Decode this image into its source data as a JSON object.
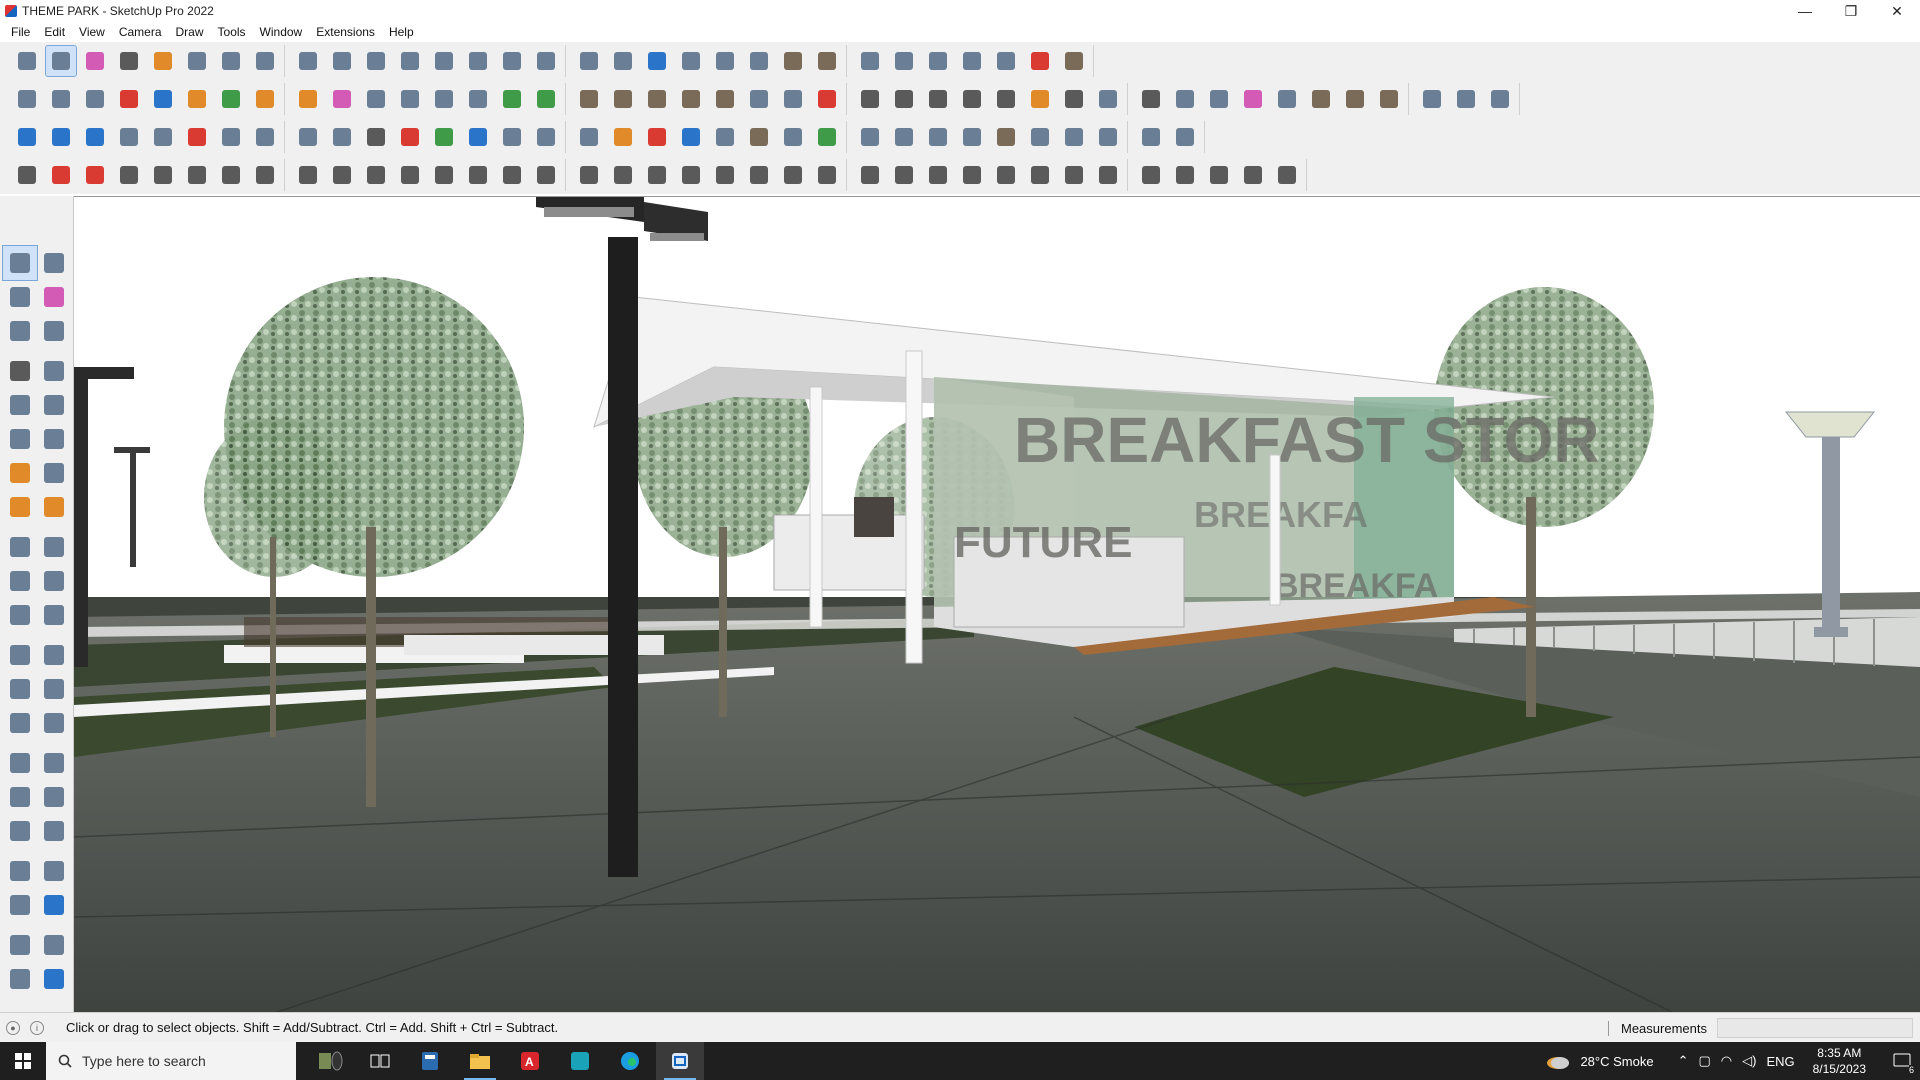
{
  "window": {
    "title": "THEME PARK - SketchUp Pro 2022",
    "controls": {
      "minimize": "—",
      "maximize": "❐",
      "close": "✕"
    }
  },
  "menu": [
    "File",
    "Edit",
    "View",
    "Camera",
    "Draw",
    "Tools",
    "Window",
    "Extensions",
    "Help"
  ],
  "toolbars": {
    "row1": [
      "zoom-icon",
      "select-icon",
      "eraser-icon",
      "line-icon",
      "arc-icon",
      "rectangle-icon",
      "push-pull-icon",
      "follow-me-icon",
      "move-icon",
      "rotate-icon",
      "scale-icon",
      "tape-measure-icon",
      "text-icon",
      "paint-bucket-icon",
      "orbit-icon",
      "pan-icon",
      "zoom-icon",
      "zoom-extents-icon",
      "section-plane-icon",
      "section-display-icon",
      "section-cut-icon",
      "section-fill-icon",
      "warehouse-icon",
      "extension-warehouse-icon",
      "layout-icon",
      "color-by-axis-icon",
      "components-icon",
      "styles-icon",
      "undo-icon",
      "redo-icon",
      "sandbox-icon"
    ],
    "row2": [
      "iso-view-icon",
      "top-view-icon",
      "front-view-icon",
      "push-pull-red-icon",
      "push-pull-blue-icon",
      "push-pull-orange-icon",
      "push-pull-green-icon",
      "push-pull-gold-icon",
      "push-pull-orange2-icon",
      "push-pull-magenta-icon",
      "soften-icon",
      "extrude-icon",
      "extrude2-icon",
      "extrude3-icon",
      "terrain-icon",
      "terrain2-icon",
      "house-icon",
      "house2-icon",
      "house3-icon",
      "house4-icon",
      "house5-icon",
      "formula-icon",
      "tag-icon",
      "pencil-red-icon",
      "rect-shape-icon",
      "circle-shape-icon",
      "polygon-shape-icon",
      "ellipse-shape-icon",
      "parallelogram-shape-icon",
      "arc-shape-icon",
      "spiral-shape-icon",
      "lasso-icon",
      "select-shape-icon",
      "target-icon",
      "dimension-icon",
      "eraser-pink-icon",
      "stairs-icon",
      "brick-icon",
      "roof-icon",
      "roof2-icon",
      "hand-icon",
      "floor-icon",
      "wall-icon"
    ],
    "row3": [
      "plane-blue-icon",
      "plane-blue2-icon",
      "plane-yellow-icon",
      "text-label-icon",
      "close-icon",
      "rect-red-icon",
      "frame-icon",
      "flag-icon",
      "door-icon",
      "bend-icon",
      "curve-dots-icon",
      "cross-red-icon",
      "cross-green-icon",
      "cross-blue-icon",
      "cone-icon",
      "tower-icon",
      "warning-icon",
      "arc-orange-icon",
      "arc-red-icon",
      "arc-blue-icon",
      "move-axis-icon",
      "box-icon",
      "arrow-back-icon",
      "tree-icon",
      "cube-group-icon",
      "cube-group2-icon",
      "gem-icon",
      "grid-icon",
      "box-outline-icon",
      "window-icon",
      "window2-icon",
      "dots-icon",
      "circle-dots-icon",
      "qr-icon"
    ],
    "row4": [
      "curve-icon",
      "spline-red-icon",
      "cube-red-icon",
      "line-tool-icon",
      "curve-tool-icon",
      "shape-icon",
      "shape2-icon",
      "shape3-icon",
      "shape4-icon",
      "shape5-icon",
      "line-a-icon",
      "line-b-icon",
      "line-c-icon",
      "line-d-icon",
      "line-e-icon",
      "line-f-icon",
      "line-g-icon",
      "line-h-icon",
      "line-i-icon",
      "line-j-icon",
      "line-k-icon",
      "line-l-icon",
      "line-m-icon",
      "line-n-icon",
      "line-o-icon",
      "line-p-icon",
      "line-q-icon",
      "line-r-icon",
      "line-s-icon",
      "line-t-icon",
      "line-u-icon",
      "line-v-icon",
      "line-w-icon",
      "line-x-icon",
      "line-y-icon",
      "line-z-icon",
      "line-aa-icon"
    ]
  },
  "tools_left": [
    [
      "select-icon",
      "orbit-icon"
    ],
    [
      "paint-bucket-icon",
      "eraser-icon"
    ],
    [
      "make-component-icon",
      "pencil-icon"
    ],
    [
      "line-icon",
      "freehand-icon"
    ],
    [
      "rectangle-icon",
      "rotated-rectangle-icon"
    ],
    [
      "circle-icon",
      "polygon-icon"
    ],
    [
      "arc-icon",
      "pie-icon"
    ],
    [
      "two-point-arc-icon",
      "three-point-arc-icon"
    ],
    [
      "move-icon",
      "push-pull-icon"
    ],
    [
      "rotate-icon",
      "follow-me-icon"
    ],
    [
      "scale-icon",
      "offset-icon"
    ],
    [
      "tape-measure-icon",
      "dimension-icon"
    ],
    [
      "protractor-icon",
      "text-icon"
    ],
    [
      "axes-icon",
      "3d-text-icon"
    ],
    [
      "orbit2-icon",
      "pan-icon"
    ],
    [
      "zoom-icon",
      "zoom-window-icon"
    ],
    [
      "zoom-extents-icon",
      "previous-view-icon"
    ],
    [
      "position-camera-icon",
      "look-around-icon"
    ],
    [
      "walk-icon",
      "section-plane-icon"
    ],
    [
      "section-display-icon",
      "section-cuts-icon"
    ],
    [
      "section-fill-icon",
      "section-plane2-icon"
    ]
  ],
  "status": {
    "message": "Click or drag to select objects. Shift = Add/Subtract. Ctrl = Add. Shift + Ctrl = Subtract.",
    "measurements_label": "Measurements",
    "measurements_value": ""
  },
  "taskbar": {
    "search_placeholder": "Type here to search",
    "weather": "28°C  Smoke",
    "language": "ENG",
    "time": "8:35 AM",
    "date": "8/15/2023",
    "notifications": "6"
  },
  "scene": {
    "sign_texts": [
      "BREAKFAST STOR",
      "FUTURE",
      "BREAKFA",
      "BREAKFA"
    ]
  },
  "colors": {
    "accent": "#0078d7",
    "sky": "#ffffff",
    "ground": "#5a5f57",
    "grass": "#3c4a30",
    "taskbar": "#1f1f1f"
  }
}
